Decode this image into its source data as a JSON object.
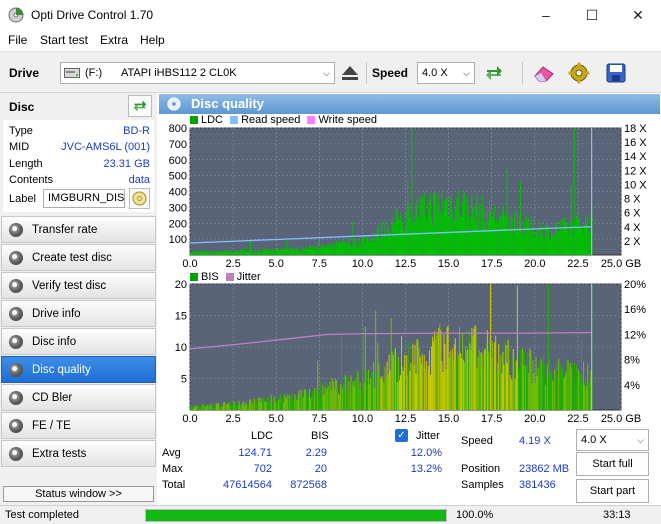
{
  "window": {
    "title": "Opti Drive Control 1.70",
    "minimize": "–",
    "maximize": "☐",
    "close": "✕"
  },
  "menu": [
    "File",
    "Start test",
    "Extra",
    "Help"
  ],
  "toolbar": {
    "drive_label": "Drive",
    "drive_letter": "(F:)",
    "drive_name": "ATAPI iHBS112  2 CL0K",
    "speed_label": "Speed",
    "speed_value": "4.0 X"
  },
  "disc": {
    "heading": "Disc",
    "type_label": "Type",
    "type_value": "BD-R",
    "mid_label": "MID",
    "mid_value": "JVC-AMS6L (001)",
    "length_label": "Length",
    "length_value": "23.31 GB",
    "contents_label": "Contents",
    "contents_value": "data",
    "label_label": "Label",
    "label_value": "IMGBURN_DIS"
  },
  "nav": [
    {
      "label": "Transfer rate",
      "active": false
    },
    {
      "label": "Create test disc",
      "active": false
    },
    {
      "label": "Verify test disc",
      "active": false
    },
    {
      "label": "Drive info",
      "active": false
    },
    {
      "label": "Disc info",
      "active": false
    },
    {
      "label": "Disc quality",
      "active": true
    },
    {
      "label": "CD Bler",
      "active": false
    },
    {
      "label": "FE / TE",
      "active": false
    },
    {
      "label": "Extra tests",
      "active": false
    }
  ],
  "status_window_btn": "Status window >>",
  "panel_title": "Disc quality",
  "colors": {
    "ldc": "#00c000",
    "read": "#80c0ff",
    "write": "#ff80ff",
    "bis": "#00a000",
    "jitter": "#c080c0",
    "plot_bg": "#5a6478",
    "active_nav": "#2a7ce0",
    "progress": "#12b812"
  },
  "chart_data": [
    {
      "type": "bar",
      "legend": [
        "LDC",
        "Read speed",
        "Write speed"
      ],
      "x_ticks": [
        "0.0",
        "2.5",
        "5.0",
        "7.5",
        "10.0",
        "12.5",
        "15.0",
        "17.5",
        "20.0",
        "22.5",
        "25.0 GB"
      ],
      "y_left_ticks": [
        "800",
        "700",
        "600",
        "500",
        "400",
        "300",
        "200",
        "100"
      ],
      "y_right_ticks": [
        "18 X",
        "16 X",
        "14 X",
        "12 X",
        "10 X",
        "8 X",
        "6 X",
        "4 X",
        "2 X"
      ],
      "xlim": [
        0,
        25
      ],
      "ylim": [
        0,
        800
      ],
      "y2lim": [
        0,
        18
      ],
      "ldc_envelope": [
        [
          0,
          20
        ],
        [
          2,
          25
        ],
        [
          4,
          30
        ],
        [
          6,
          40
        ],
        [
          8,
          60
        ],
        [
          10,
          100
        ],
        [
          11,
          160
        ],
        [
          12,
          230
        ],
        [
          13,
          290
        ],
        [
          14,
          330
        ],
        [
          15,
          360
        ],
        [
          16,
          330
        ],
        [
          17,
          290
        ],
        [
          18,
          250
        ],
        [
          19,
          210
        ],
        [
          20,
          180
        ],
        [
          21,
          170
        ],
        [
          22,
          190
        ],
        [
          23.3,
          240
        ]
      ],
      "read_speed": [
        [
          0,
          1.7
        ],
        [
          5,
          2.2
        ],
        [
          10,
          2.7
        ],
        [
          15,
          3.2
        ],
        [
          20,
          3.7
        ],
        [
          23.3,
          4.0
        ]
      ]
    },
    {
      "type": "bar",
      "legend": [
        "BIS",
        "Jitter"
      ],
      "x_ticks": [
        "0.0",
        "2.5",
        "5.0",
        "7.5",
        "10.0",
        "12.5",
        "15.0",
        "17.5",
        "20.0",
        "22.5",
        "25.0 GB"
      ],
      "y_left_ticks": [
        "20",
        "15",
        "10",
        "5"
      ],
      "y_right_ticks": [
        "20%",
        "16%",
        "12%",
        "8%",
        "4%"
      ],
      "xlim": [
        0,
        25
      ],
      "ylim": [
        0,
        20
      ],
      "y2lim": [
        0,
        20
      ],
      "bis_envelope": [
        [
          0,
          0.6
        ],
        [
          3,
          1.2
        ],
        [
          5,
          2
        ],
        [
          7,
          3
        ],
        [
          9,
          4.5
        ],
        [
          11,
          6.5
        ],
        [
          12.5,
          8.5
        ],
        [
          14,
          10
        ],
        [
          15,
          11.5
        ],
        [
          16,
          11
        ],
        [
          17.5,
          9.5
        ],
        [
          19,
          8.5
        ],
        [
          20.5,
          7
        ],
        [
          22,
          6.5
        ],
        [
          23.3,
          6
        ]
      ],
      "jitter": [
        [
          0,
          9.7
        ],
        [
          3,
          10.5
        ],
        [
          6,
          11.4
        ],
        [
          8,
          12.0
        ],
        [
          10,
          12.1
        ],
        [
          15,
          12.2
        ],
        [
          20,
          12.2
        ],
        [
          23.3,
          12.3
        ]
      ]
    }
  ],
  "stats": {
    "ldc_header": "LDC",
    "bis_header": "BIS",
    "jitter_header": "Jitter",
    "avg_label": "Avg",
    "avg_ldc": "124.71",
    "avg_bis": "2.29",
    "avg_jitter": "12.0%",
    "max_label": "Max",
    "max_ldc": "702",
    "max_bis": "20",
    "max_jitter": "13.2%",
    "total_label": "Total",
    "total_ldc": "47614564",
    "total_bis": "872568",
    "speed_label": "Speed",
    "speed_value": "4.19 X",
    "speed_select": "4.0 X",
    "position_label": "Position",
    "position_value": "23862 MB",
    "samples_label": "Samples",
    "samples_value": "381436",
    "start_full": "Start full",
    "start_part": "Start part"
  },
  "status": {
    "text": "Test completed",
    "progress": 100.0,
    "progress_text": "100.0%",
    "time": "33:13"
  }
}
